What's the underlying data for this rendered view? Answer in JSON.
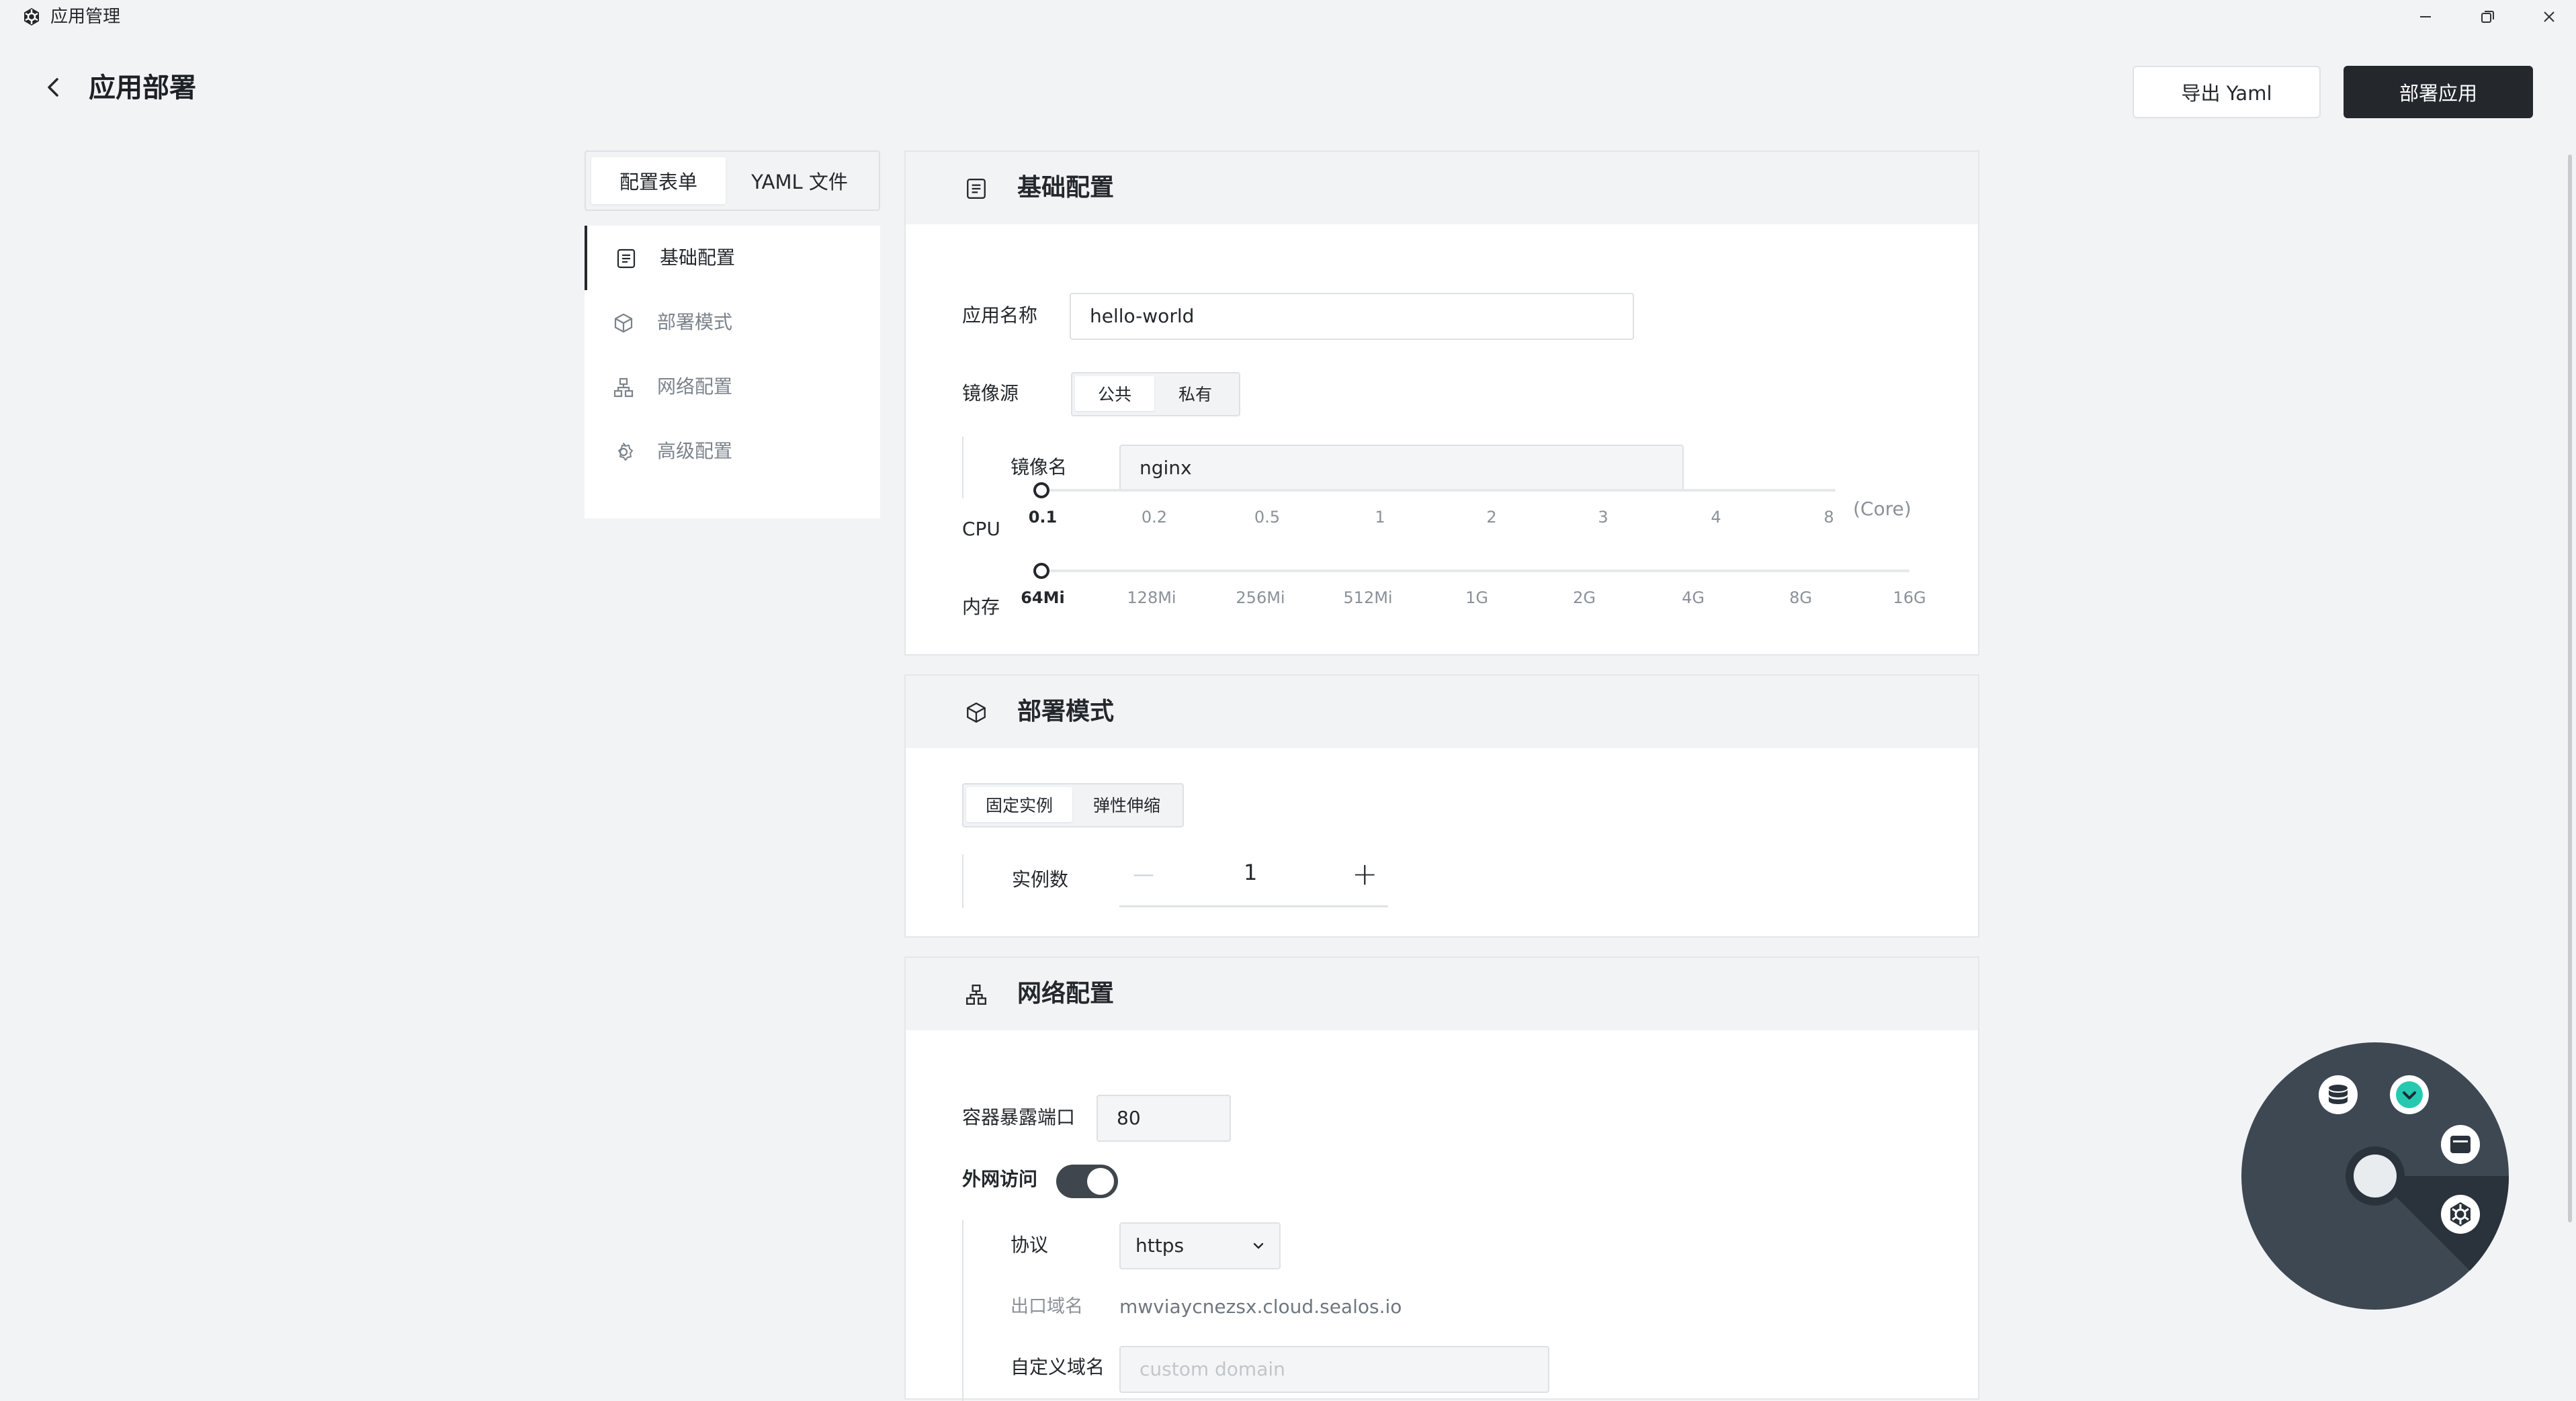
{
  "window": {
    "title": "应用管理"
  },
  "header": {
    "title": "应用部署",
    "export_label": "导出 Yaml",
    "deploy_label": "部署应用"
  },
  "tabs": [
    {
      "label": "配置表单",
      "active": true
    },
    {
      "label": "YAML 文件",
      "active": false
    }
  ],
  "nav": {
    "items": [
      {
        "label": "基础配置",
        "icon": "document-icon",
        "active": true
      },
      {
        "label": "部署模式",
        "icon": "cube-icon",
        "active": false
      },
      {
        "label": "网络配置",
        "icon": "network-icon",
        "active": false
      },
      {
        "label": "高级配置",
        "icon": "gear-icon",
        "active": false
      }
    ]
  },
  "basic": {
    "title": "基础配置",
    "app_name_label": "应用名称",
    "app_name_value": "hello-world",
    "image_source_label": "镜像源",
    "image_source_options": [
      "公共",
      "私有"
    ],
    "image_source_selected": "公共",
    "image_name_label": "镜像名",
    "image_name_value": "nginx",
    "cpu": {
      "label": "CPU",
      "ticks": [
        "0.1",
        "0.2",
        "0.5",
        "1",
        "2",
        "3",
        "4",
        "8"
      ],
      "unit": "(Core)",
      "value": "0.1"
    },
    "memory": {
      "label": "内存",
      "ticks": [
        "64Mi",
        "128Mi",
        "256Mi",
        "512Mi",
        "1G",
        "2G",
        "4G",
        "8G",
        "16G"
      ],
      "value": "64Mi"
    }
  },
  "deploy_mode": {
    "title": "部署模式",
    "options": [
      "固定实例",
      "弹性伸缩"
    ],
    "selected": "固定实例",
    "replicas_label": "实例数",
    "replicas_value": "1",
    "minus": "—",
    "plus": "+"
  },
  "network": {
    "title": "网络配置",
    "port_label": "容器暴露端口",
    "port_value": "80",
    "public_access_label": "外网访问",
    "public_access_on": true,
    "protocol_label": "协议",
    "protocol_value": "https",
    "domain_label": "出口域名",
    "domain_value": "mwviaycnezsx.cloud.sealos.io",
    "custom_domain_label": "自定义域名",
    "custom_domain_placeholder": "custom domain"
  },
  "colors": {
    "primary_dark": "#24282c",
    "background": "#f2f3f5",
    "launcher": "#3e4853",
    "launcher_accent": "#25c9b0"
  }
}
